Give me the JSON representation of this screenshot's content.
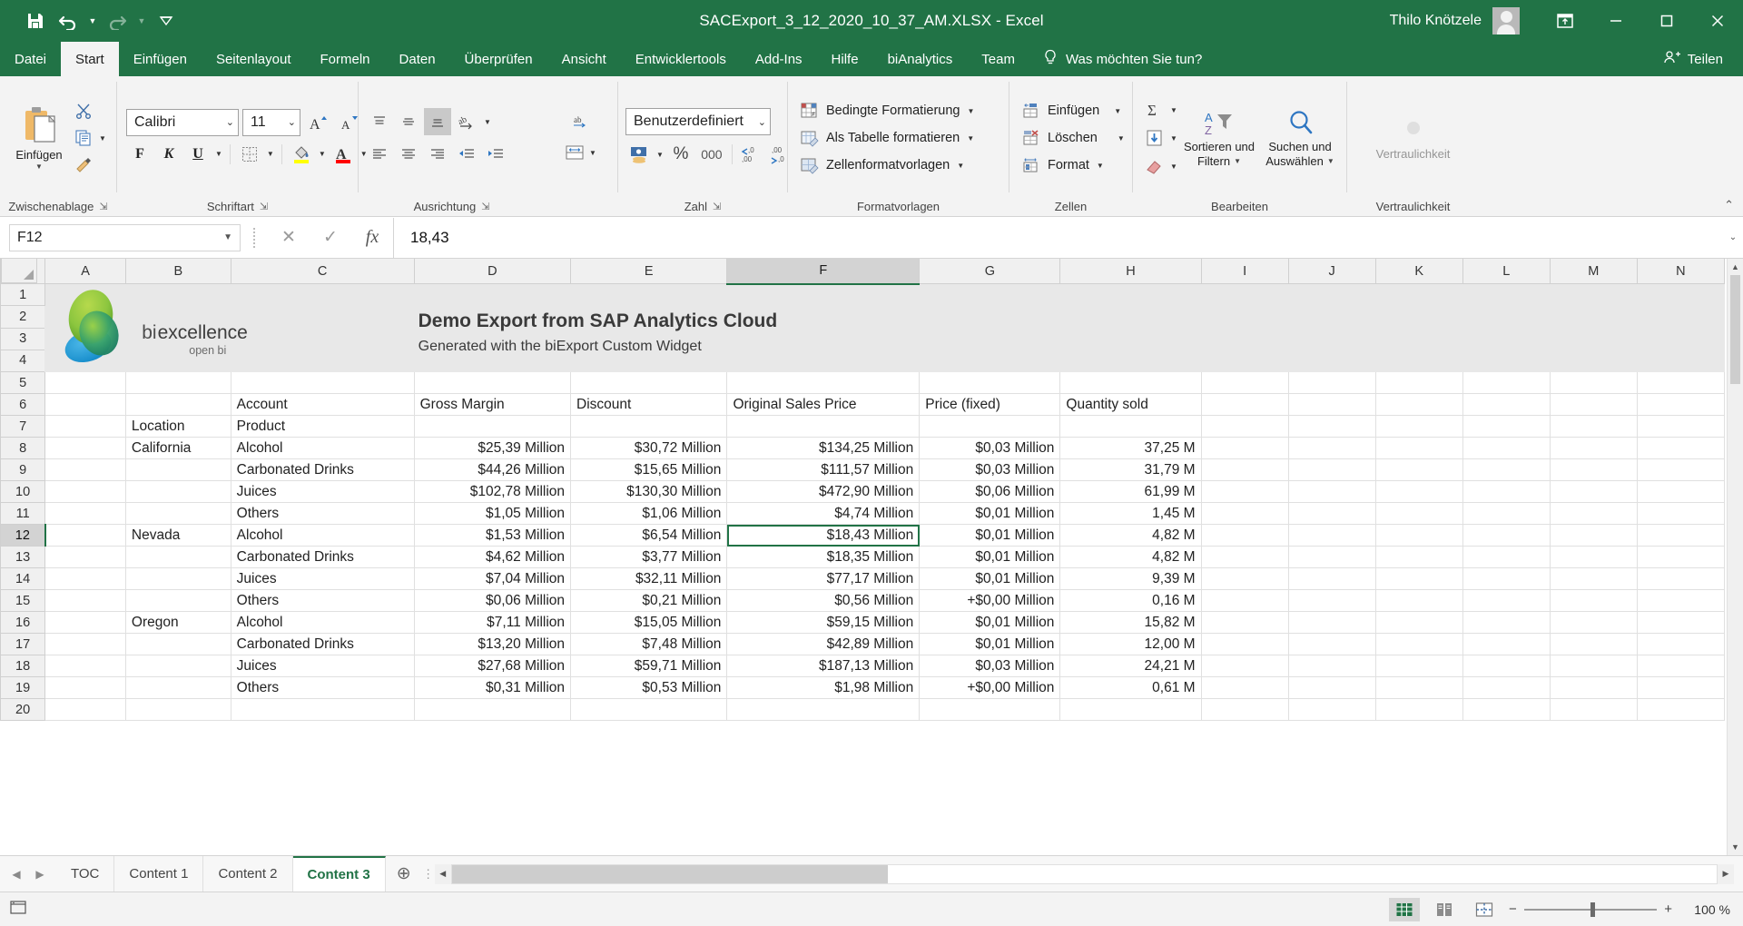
{
  "titlebar": {
    "quick_access": [
      {
        "name": "save",
        "icon": "save-icon"
      },
      {
        "name": "undo",
        "icon": "undo-icon"
      },
      {
        "name": "redo",
        "icon": "redo-icon"
      },
      {
        "name": "customize",
        "icon": "chevron-down-icon"
      }
    ],
    "title": "SACExport_3_12_2020_10_37_AM.XLSX  -  Excel",
    "user": "Thilo Knötzele",
    "ribbon_display_options": "ribbon-display-options-icon",
    "minimize": "minimize-icon",
    "maximize": "maximize-icon",
    "close": "close-icon"
  },
  "ribbon_tabs": [
    {
      "label": "Datei",
      "active": false
    },
    {
      "label": "Start",
      "active": true
    },
    {
      "label": "Einfügen",
      "active": false
    },
    {
      "label": "Seitenlayout",
      "active": false
    },
    {
      "label": "Formeln",
      "active": false
    },
    {
      "label": "Daten",
      "active": false
    },
    {
      "label": "Überprüfen",
      "active": false
    },
    {
      "label": "Ansicht",
      "active": false
    },
    {
      "label": "Entwicklertools",
      "active": false
    },
    {
      "label": "Add-Ins",
      "active": false
    },
    {
      "label": "Hilfe",
      "active": false
    },
    {
      "label": "biAnalytics",
      "active": false
    },
    {
      "label": "Team",
      "active": false
    }
  ],
  "tell_me": "Was möchten Sie tun?",
  "share": "Teilen",
  "ribbon": {
    "clipboard": {
      "label": "Zwischenablage",
      "paste": "Einfügen",
      "cut": "Ausschneiden",
      "copy": "Kopieren",
      "format_painter": "Format übertragen"
    },
    "font": {
      "label": "Schriftart",
      "font_name": "Calibri",
      "font_size": "11",
      "grow": "A",
      "shrink": "A",
      "bold": "F",
      "italic": "K",
      "underline": "U",
      "borders": "borders-icon",
      "fill_color": "fill-color-icon",
      "font_color": "font-color-icon"
    },
    "alignment": {
      "label": "Ausrichtung",
      "align_top": "align-top-icon",
      "align_middle": "align-middle-icon",
      "align_bottom": "align-bottom-icon",
      "orientation": "orientation-icon",
      "align_left": "align-left-icon",
      "align_center": "align-center-icon",
      "align_right": "align-right-icon",
      "decrease_indent": "decrease-indent-icon",
      "increase_indent": "increase-indent-icon",
      "wrap_text": "wrap-text-icon",
      "merge_cells": "merge-cells-icon"
    },
    "number": {
      "label": "Zahl",
      "format": "Benutzerdefiniert",
      "accounting": "accounting-icon",
      "percent": "%",
      "thousands": "000",
      "increase_decimal": "increase-decimal-icon",
      "decrease_decimal": "decrease-decimal-icon"
    },
    "styles": {
      "label": "Formatvorlagen",
      "items": [
        "Bedingte Formatierung",
        "Als Tabelle formatieren",
        "Zellenformatvorlagen"
      ]
    },
    "cells": {
      "label": "Zellen",
      "items": [
        "Einfügen",
        "Löschen",
        "Format"
      ]
    },
    "editing": {
      "label": "Bearbeiten",
      "autosum": "autosum-icon",
      "fill": "fill-icon",
      "clear": "clear-icon",
      "sort_filter": "Sortieren und\nFiltern",
      "sort_filter_l1": "Sortieren und",
      "sort_filter_l2": "Filtern",
      "find_select_l1": "Suchen und",
      "find_select_l2": "Auswählen"
    },
    "sensitivity": {
      "label": "Vertraulichkeit",
      "button": "Vertraulichkeit"
    }
  },
  "formulabar": {
    "namebox": "F12",
    "cancel": "cancel-icon",
    "enter": "enter-icon",
    "insert_function": "fx",
    "value": "18,43"
  },
  "grid": {
    "columns": [
      "A",
      "B",
      "C",
      "D",
      "E",
      "F",
      "G",
      "H",
      "I",
      "J",
      "K",
      "L",
      "M",
      "N"
    ],
    "selected_column": "F",
    "selected_row": "12",
    "rows": [
      "1",
      "2",
      "3",
      "4",
      "5",
      "6",
      "7",
      "8",
      "9",
      "10",
      "11",
      "12",
      "13",
      "14",
      "15",
      "16",
      "17",
      "18",
      "19",
      "20"
    ],
    "banner": {
      "title": "Demo Export from SAP Analytics Cloud",
      "subtitle": "Generated with the biExport Custom Widget",
      "logo_name": "biexcellence",
      "logo_bi": "bi",
      "logo_rest": "excellence",
      "logo_tagline": "open bi"
    },
    "table": {
      "header_account": "Account",
      "header_location": "Location",
      "header_product": "Product",
      "measures": [
        "Gross Margin",
        "Discount",
        "Original Sales Price",
        "Price (fixed)",
        "Quantity sold"
      ],
      "rows": [
        {
          "row": "8",
          "location": "California",
          "product": "Alcohol",
          "values": [
            "$25,39 Million",
            "$30,72 Million",
            "$134,25 Million",
            "$0,03 Million",
            "37,25 M"
          ]
        },
        {
          "row": "9",
          "location": "",
          "product": "Carbonated Drinks",
          "values": [
            "$44,26 Million",
            "$15,65 Million",
            "$111,57 Million",
            "$0,03 Million",
            "31,79 M"
          ]
        },
        {
          "row": "10",
          "location": "",
          "product": "Juices",
          "values": [
            "$102,78 Million",
            "$130,30 Million",
            "$472,90 Million",
            "$0,06 Million",
            "61,99 M"
          ]
        },
        {
          "row": "11",
          "location": "",
          "product": "Others",
          "values": [
            "$1,05 Million",
            "$1,06 Million",
            "$4,74 Million",
            "$0,01 Million",
            "1,45 M"
          ]
        },
        {
          "row": "12",
          "location": "Nevada",
          "product": "Alcohol",
          "values": [
            "$1,53 Million",
            "$6,54 Million",
            "$18,43 Million",
            "$0,01 Million",
            "4,82 M"
          ]
        },
        {
          "row": "13",
          "location": "",
          "product": "Carbonated Drinks",
          "values": [
            "$4,62 Million",
            "$3,77 Million",
            "$18,35 Million",
            "$0,01 Million",
            "4,82 M"
          ]
        },
        {
          "row": "14",
          "location": "",
          "product": "Juices",
          "values": [
            "$7,04 Million",
            "$32,11 Million",
            "$77,17 Million",
            "$0,01 Million",
            "9,39 M"
          ]
        },
        {
          "row": "15",
          "location": "",
          "product": "Others",
          "values": [
            "$0,06 Million",
            "$0,21 Million",
            "$0,56 Million",
            "+$0,00 Million",
            "0,16 M"
          ]
        },
        {
          "row": "16",
          "location": "Oregon",
          "product": "Alcohol",
          "values": [
            "$7,11 Million",
            "$15,05 Million",
            "$59,15 Million",
            "$0,01 Million",
            "15,82 M"
          ]
        },
        {
          "row": "17",
          "location": "",
          "product": "Carbonated Drinks",
          "values": [
            "$13,20 Million",
            "$7,48 Million",
            "$42,89 Million",
            "$0,01 Million",
            "12,00 M"
          ]
        },
        {
          "row": "18",
          "location": "",
          "product": "Juices",
          "values": [
            "$27,68 Million",
            "$59,71 Million",
            "$187,13 Million",
            "$0,03 Million",
            "24,21 M"
          ]
        },
        {
          "row": "19",
          "location": "",
          "product": "Others",
          "values": [
            "$0,31 Million",
            "$0,53 Million",
            "$1,98 Million",
            "+$0,00 Million",
            "0,61 M"
          ]
        }
      ]
    }
  },
  "sheet_tabs": {
    "items": [
      {
        "label": "TOC",
        "active": false
      },
      {
        "label": "Content 1",
        "active": false
      },
      {
        "label": "Content 2",
        "active": false
      },
      {
        "label": "Content 3",
        "active": true
      }
    ],
    "add_label": "+"
  },
  "statusbar": {
    "accessibility": "accessibility-icon",
    "view_normal": "view-normal-icon",
    "view_pagelayout": "view-page-layout-icon",
    "view_pagebreak": "view-page-break-icon",
    "zoom_out": "−",
    "zoom_in": "+",
    "zoom_level": "100 %"
  },
  "colors": {
    "excel_green": "#217346",
    "ribbon_bg": "#f3f3f3",
    "selection_green": "#217346",
    "header_gray": "#f0f0f0"
  }
}
